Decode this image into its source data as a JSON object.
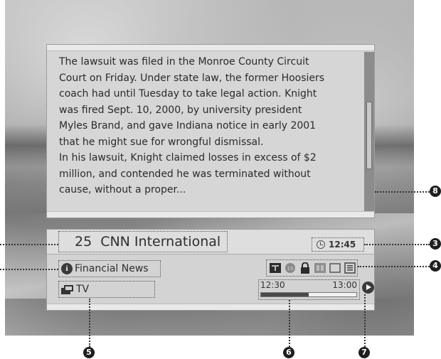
{
  "article": {
    "lines": [
      "The lawsuit was filed in the Monroe County Circuit",
      "Court on Friday. Under state law, the former Hoosiers",
      "coach had until Tuesday to take legal action. Knight",
      "was fired Sept. 10, 2000, by university president",
      "Myles Brand, and gave Indiana notice in early 2001",
      "that he might sue for wrongful dismissal.",
      "In his lawsuit, Knight claimed losses in excess of $2",
      "million, and contended he was terminated without",
      "cause, without a proper..."
    ]
  },
  "channel": {
    "number": "25",
    "name": "CNN International"
  },
  "clock": {
    "time": "12:45",
    "icon": "clock-icon"
  },
  "program": {
    "genre": "Financial News",
    "genre_icon": "info-icon",
    "type": "TV",
    "type_icon": "tv-icon",
    "start": "12:30",
    "end": "13:00",
    "progress_fraction": 0.5
  },
  "service_icons": [
    "teletext-icon",
    "age-rating-icon",
    "lock-icon",
    "epg-icon",
    "subtitle-icon",
    "audio-list-icon"
  ],
  "callouts": [
    "5",
    "6",
    "7",
    "8",
    "3",
    "4"
  ],
  "colors": {
    "badge": "#1e1e1e",
    "panel": "#d6d6d6"
  }
}
